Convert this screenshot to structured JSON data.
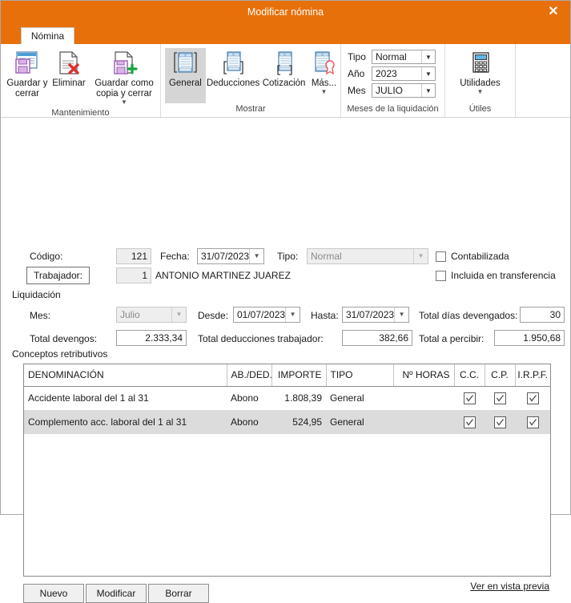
{
  "window": {
    "title": "Modificar nómina",
    "close_label": "✕"
  },
  "tabs": [
    {
      "label": "Nómina"
    }
  ],
  "ribbon": {
    "groups": [
      {
        "title": "Mantenimiento",
        "buttons": [
          {
            "label": "Guardar y cerrar",
            "icon": "save-close-icon"
          },
          {
            "label": "Eliminar",
            "icon": "delete-document-icon"
          },
          {
            "label": "Guardar como copia y cerrar",
            "icon": "save-copy-icon",
            "has_menu": true
          }
        ]
      },
      {
        "title": "Mostrar",
        "buttons": [
          {
            "label": "General",
            "icon": "document-general-icon",
            "selected": true
          },
          {
            "label": "Deducciones",
            "icon": "document-deductions-icon"
          },
          {
            "label": "Cotización",
            "icon": "document-contribution-icon"
          },
          {
            "label": "Más...",
            "icon": "document-more-icon",
            "has_menu": true
          }
        ]
      },
      {
        "title": "Meses de la liquidación",
        "dropdowns": [
          {
            "label": "Tipo",
            "value": "Normal"
          },
          {
            "label": "Año",
            "value": "2023"
          },
          {
            "label": "Mes",
            "value": "JULIO"
          }
        ]
      },
      {
        "title": "Útiles",
        "buttons": [
          {
            "label": "Utilidades",
            "icon": "calculator-icon",
            "has_menu": true
          }
        ]
      }
    ]
  },
  "form": {
    "codigo_label": "Código:",
    "codigo_value": "121",
    "fecha_label": "Fecha:",
    "fecha_value": "31/07/2023",
    "tipo_label": "Tipo:",
    "tipo_value": "Normal",
    "trabajador_button": "Trabajador:",
    "trabajador_code": "1",
    "trabajador_name": "ANTONIO MARTINEZ JUAREZ",
    "contabilizada_label": "Contabilizada",
    "contabilizada_checked": false,
    "transferencia_label": "Incluida en transferencia",
    "transferencia_checked": false,
    "liquidacion_label": "Liquidación",
    "mes_label": "Mes:",
    "mes_value": "Julio",
    "desde_label": "Desde:",
    "desde_value": "01/07/2023",
    "hasta_label": "Hasta:",
    "hasta_value": "31/07/2023",
    "total_dias_label": "Total días devengados:",
    "total_dias_value": "30",
    "total_devengos_label": "Total devengos:",
    "total_devengos_value": "2.333,34",
    "total_deducciones_label": "Total deducciones trabajador:",
    "total_deducciones_value": "382,66",
    "total_percibir_label": "Total a percibir:",
    "total_percibir_value": "1.950,68"
  },
  "grid": {
    "caption": "Conceptos retributivos",
    "columns": [
      "DENOMINACIÓN",
      "AB./DED.",
      "IMPORTE",
      "TIPO",
      "Nº HORAS",
      "C.C.",
      "C.P.",
      "I.R.P.F."
    ],
    "rows": [
      {
        "denominacion": "Accidente laboral del 1 al 31",
        "ab_ded": "Abono",
        "importe": "1.808,39",
        "tipo": "General",
        "horas": "",
        "cc": true,
        "cp": true,
        "irpf": true
      },
      {
        "denominacion": "Complemento acc. laboral del 1 al 31",
        "ab_ded": "Abono",
        "importe": "524,95",
        "tipo": "General",
        "horas": "",
        "cc": true,
        "cp": true,
        "irpf": true
      }
    ]
  },
  "footer": {
    "nuevo": "Nuevo",
    "modificar": "Modificar",
    "borrar": "Borrar",
    "preview_link": "Ver en vista previa"
  },
  "colors": {
    "accent": "#E8700A",
    "selected_tile": "#d5d5d5",
    "row_alt": "#dcdcdc"
  }
}
